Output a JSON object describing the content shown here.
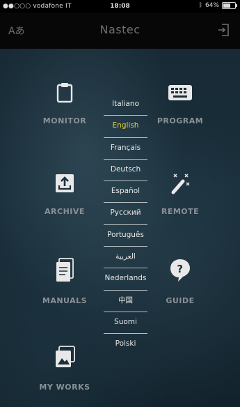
{
  "status_bar": {
    "carrier": "●●○○○ vodafone IT",
    "time": "18:08",
    "battery": "64%",
    "battery_level": 0.64
  },
  "navbar": {
    "left_label": "Aあ",
    "title": "Nastec",
    "right_icon": "logout-icon"
  },
  "tiles": [
    {
      "label": "MONITOR",
      "icon": "clipboard-icon"
    },
    {
      "label": "PROGRAM",
      "icon": "keyboard-icon"
    },
    {
      "label": "ARCHIVE",
      "icon": "archive-upload-icon"
    },
    {
      "label": "REMOTE",
      "icon": "remote-wand-icon"
    },
    {
      "label": "MANUALS",
      "icon": "document-icon"
    },
    {
      "label": "GUIDE",
      "icon": "question-bubble-icon"
    },
    {
      "label": "MY WORKS",
      "icon": "photo-icon"
    }
  ],
  "languages": [
    "Italiano",
    "English",
    "Français",
    "Deutsch",
    "Español",
    "Русский",
    "Português",
    "العربية",
    "Nederlands",
    "中国",
    "Suomi",
    "Polski"
  ],
  "selected_language": "English",
  "colors": {
    "selected": "#e6d23b",
    "tile_text": "#8a9196",
    "navbar_bg": "#070707"
  }
}
